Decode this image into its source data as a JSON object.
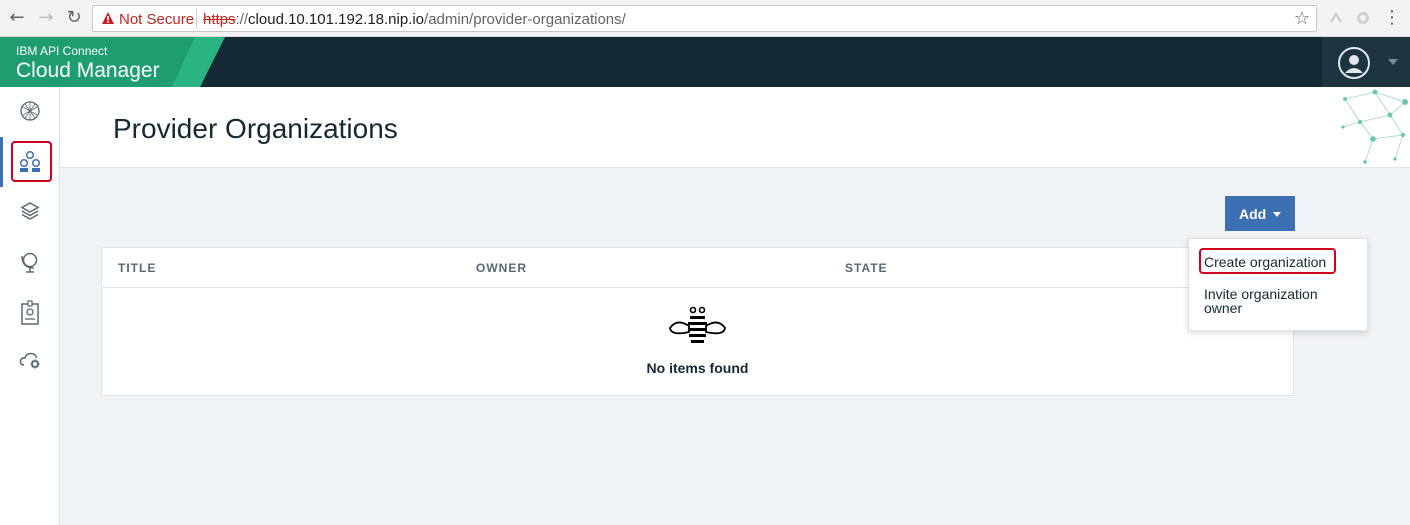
{
  "browser": {
    "nav": {
      "back_icon": "←",
      "forward_icon": "→",
      "reload_icon": "↻"
    },
    "security_label": "Not Secure",
    "url": {
      "scheme": "https",
      "host": "cloud.10.101.192.18.nip.io",
      "path": "/admin/provider-organizations/"
    },
    "url_separator": "://",
    "bookmark_icon": "☆",
    "menu_icon": "⋮"
  },
  "header": {
    "product_small": "IBM API Connect",
    "product_large": "Cloud Manager",
    "brand_color": "#1e9e6f"
  },
  "sidebar": {
    "items": [
      {
        "icon": "globe-mesh-icon"
      },
      {
        "icon": "provider-organizations-icon",
        "active": true
      },
      {
        "icon": "layers-icon"
      },
      {
        "icon": "globe-stand-icon"
      },
      {
        "icon": "badge-icon"
      },
      {
        "icon": "cloud-settings-icon"
      }
    ]
  },
  "page": {
    "title": "Provider Organizations"
  },
  "toolbar": {
    "add_label": "Add"
  },
  "table": {
    "columns": [
      "TITLE",
      "OWNER",
      "STATE"
    ],
    "empty_message": "No items found"
  },
  "dropdown": {
    "items": [
      "Create organization",
      "Invite organization owner"
    ]
  },
  "colors": {
    "accent": "#3d70b2",
    "header_bg": "#152935",
    "highlight": "#d0021b"
  }
}
